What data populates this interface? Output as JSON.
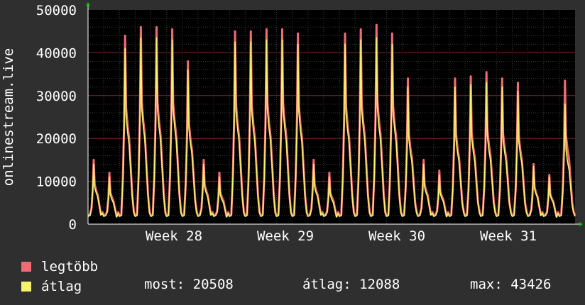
{
  "chart_data": {
    "type": "area",
    "ylabel": "onlinestream.live",
    "ylim": [
      0,
      50000
    ],
    "y_ticks": [
      "0",
      "10000",
      "20000",
      "30000",
      "40000",
      "50000"
    ],
    "x_ticks": [
      "Week 28",
      "Week 29",
      "Week 30",
      "Week 31"
    ],
    "days": 31,
    "series": [
      {
        "name": "legtöbb",
        "color": "#f06b74",
        "daily_peaks": [
          15000,
          12000,
          44000,
          46000,
          46000,
          45500,
          38000,
          15000,
          12000,
          45000,
          45000,
          45500,
          45500,
          44500,
          15000,
          12000,
          44500,
          45500,
          46500,
          44500,
          34000,
          15000,
          12500,
          34000,
          34500,
          35500,
          34000,
          33000,
          14000,
          11500,
          33500
        ]
      },
      {
        "name": "átlag",
        "color": "#f5f36b",
        "daily_peaks": [
          14000,
          11000,
          41000,
          43500,
          43500,
          43000,
          36000,
          14000,
          11000,
          42500,
          42500,
          43000,
          43000,
          42000,
          14000,
          11000,
          42000,
          43000,
          43500,
          42000,
          32000,
          14000,
          11500,
          32000,
          32500,
          33000,
          32000,
          31000,
          13500,
          11000,
          28000
        ]
      }
    ],
    "grid": true
  },
  "legend": {
    "max_label": "legtöbb",
    "avg_label": "átlag",
    "max_color": "#f06b74",
    "avg_color": "#f5f36b"
  },
  "stats": {
    "now": "most: 20508",
    "avg": "átlag: 12088",
    "max": "max: 43426"
  }
}
